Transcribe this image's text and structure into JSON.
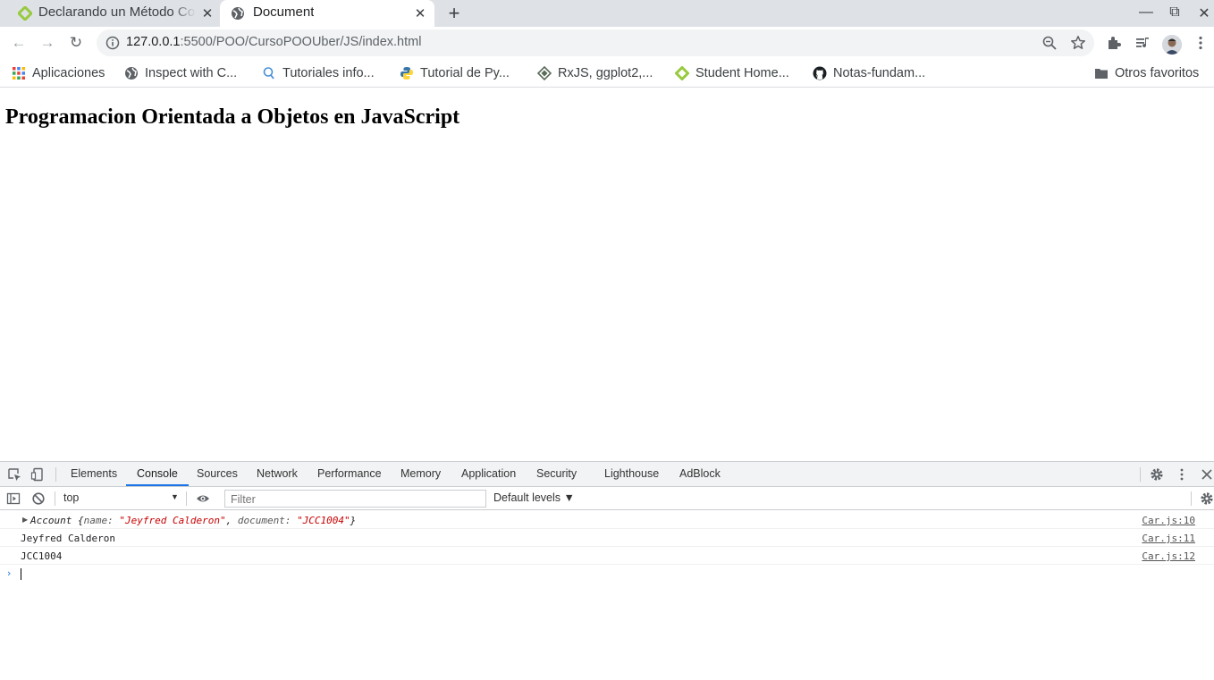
{
  "tabs": [
    {
      "title": "Declarando un Método Co",
      "active": false,
      "close": "✕"
    },
    {
      "title": "Document",
      "active": true,
      "close": "✕"
    }
  ],
  "new_tab": "+",
  "window_controls": {
    "minimize": "—",
    "restore": "⧉",
    "close": "✕"
  },
  "omnibox": {
    "host": "127.0.0.1",
    "rest": ":5500/POO/CursoPOOUber/JS/index.html"
  },
  "bookmarks": [
    {
      "label": "Aplicaciones",
      "icon": "apps-grid-icon"
    },
    {
      "label": "Inspect with C...",
      "icon": "globe-icon"
    },
    {
      "label": "Tutoriales info...",
      "icon": "search-bubble-icon"
    },
    {
      "label": "Tutorial de Py...",
      "icon": "python-icon"
    },
    {
      "label": "RxJS, ggplot2,...",
      "icon": "diamond-icon"
    },
    {
      "label": "Student Home...",
      "icon": "platzi-icon"
    },
    {
      "label": "Notas-fundam...",
      "icon": "github-icon"
    }
  ],
  "other_bookmarks": "Otros favoritos",
  "page": {
    "heading": "Programacion Orientada a Objetos en JavaScript"
  },
  "devtools": {
    "tabs": [
      "Elements",
      "Console",
      "Sources",
      "Network",
      "Performance",
      "Memory",
      "Application",
      "Security",
      "Lighthouse",
      "AdBlock"
    ],
    "active_tab": "Console",
    "context": "top",
    "filter_placeholder": "Filter",
    "levels": "Default levels ▼",
    "console": [
      {
        "type": "object",
        "class_name": "Account",
        "brace_open": " {",
        "k1": "name",
        "v1": "\"Jeyfred Calderon\"",
        "sep": ", ",
        "k2": "document",
        "v2": "\"JCC1004\"",
        "brace_close": "}",
        "colon": ": ",
        "source": "Car.js:10"
      },
      {
        "type": "text",
        "text": "Jeyfred Calderon",
        "source": "Car.js:11"
      },
      {
        "type": "text",
        "text": "JCC1004",
        "source": "Car.js:12"
      }
    ],
    "prompt": "›"
  },
  "colors": {
    "accent": "#1a73e8",
    "tabstrip": "#dee1e6",
    "string": "#c80000"
  }
}
